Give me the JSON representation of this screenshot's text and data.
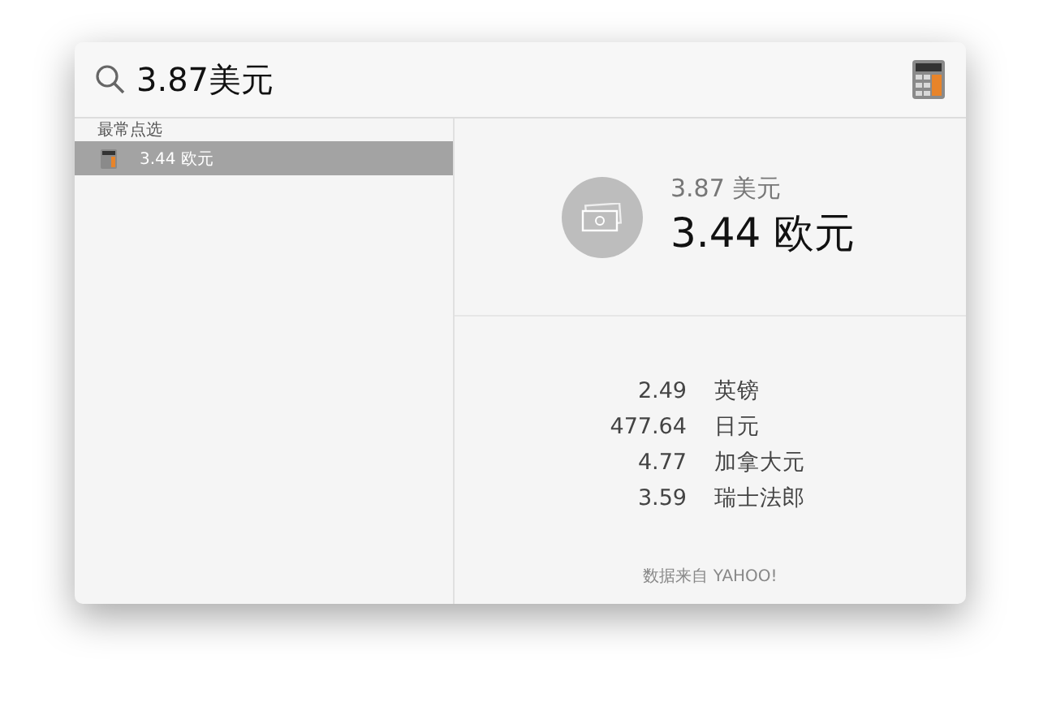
{
  "search": {
    "value": "3.87美元"
  },
  "results": {
    "section": "最常点选",
    "items": [
      {
        "label": "3.44 欧元",
        "selected": true
      }
    ]
  },
  "conversion": {
    "from": "3.87 美元",
    "to": "3.44 欧元"
  },
  "rates": [
    {
      "amount": "2.49",
      "currency": "英镑"
    },
    {
      "amount": "477.64",
      "currency": "日元"
    },
    {
      "amount": "4.77",
      "currency": "加拿大元"
    },
    {
      "amount": "3.59",
      "currency": "瑞士法郎"
    }
  ],
  "source": "数据来自 YAHOO!"
}
